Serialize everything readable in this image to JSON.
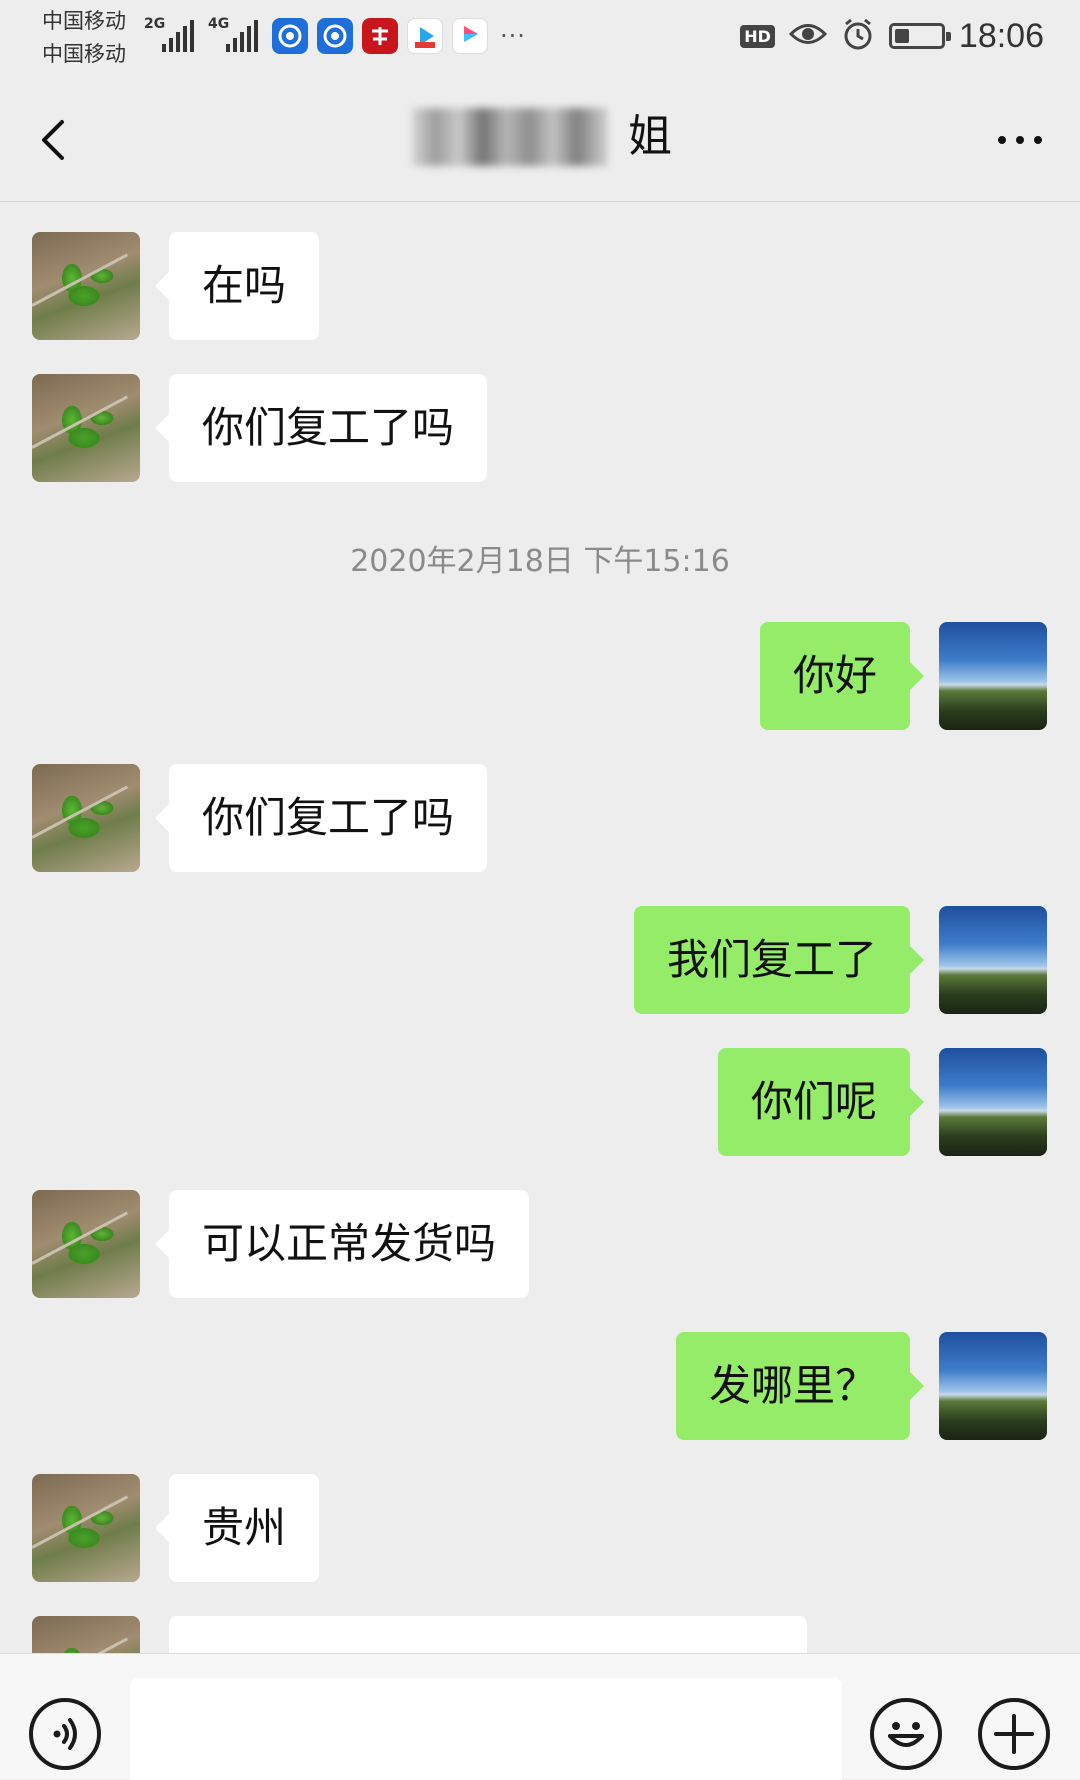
{
  "status_bar": {
    "carrier_1": "中国移动",
    "carrier_2": "中国移动",
    "network_1": "2G",
    "network_2": "4G",
    "more": "···",
    "hd": "HD",
    "time": "18:06",
    "icons": [
      "signal-icon",
      "weibo-icon",
      "weibo-icon",
      "xuexi-icon",
      "video-app-icon",
      "youku-icon",
      "eye-icon",
      "alarm-icon",
      "battery-icon"
    ]
  },
  "header": {
    "title_visible": "姐",
    "back_icon": "chevron-left-icon",
    "more_icon": "more-dots-icon"
  },
  "messages": [
    {
      "side": "in",
      "text": "在吗"
    },
    {
      "side": "in",
      "text": "你们复工了吗"
    },
    {
      "side": "time",
      "text": "2020年2月18日 下午15:16"
    },
    {
      "side": "out",
      "text": "你好"
    },
    {
      "side": "in",
      "text": "你们复工了吗"
    },
    {
      "side": "out",
      "text": "我们复工了"
    },
    {
      "side": "out",
      "text": "你们呢"
    },
    {
      "side": "in",
      "text": "可以正常发货吗"
    },
    {
      "side": "out",
      "text": "发哪里？"
    },
    {
      "side": "in",
      "text": "贵州"
    }
  ],
  "input_bar": {
    "voice_icon": "voice-icon",
    "emoji_icon": "emoji-icon",
    "plus_icon": "plus-icon",
    "input_value": ""
  },
  "colors": {
    "background": "#ededed",
    "bubble_out": "#95ec69",
    "bubble_in": "#ffffff"
  }
}
